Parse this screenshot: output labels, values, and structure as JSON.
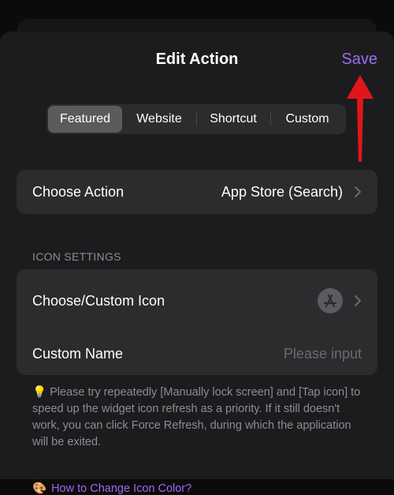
{
  "header": {
    "title": "Edit Action",
    "save_label": "Save"
  },
  "tabs": [
    {
      "label": "Featured",
      "active": true
    },
    {
      "label": "Website",
      "active": false
    },
    {
      "label": "Shortcut",
      "active": false
    },
    {
      "label": "Custom",
      "active": false
    }
  ],
  "action_row": {
    "label": "Choose Action",
    "value": "App Store (Search)"
  },
  "icon_settings": {
    "header": "ICON SETTINGS",
    "icon_row_label": "Choose/Custom Icon",
    "name_row_label": "Custom Name",
    "name_placeholder": "Please input"
  },
  "note": {
    "bulb": "💡",
    "text": "Please try repeatedly [Manually lock screen] and [Tap icon] to speed up the widget icon refresh as a priority. If it still doesn't work, you can click Force Refresh, during which the application will be exited."
  },
  "link": {
    "emoji": "🎨",
    "label": "How to Change Icon Color?"
  },
  "colors": {
    "accent": "#9a6df2",
    "annotation_arrow": "#e0161b"
  }
}
